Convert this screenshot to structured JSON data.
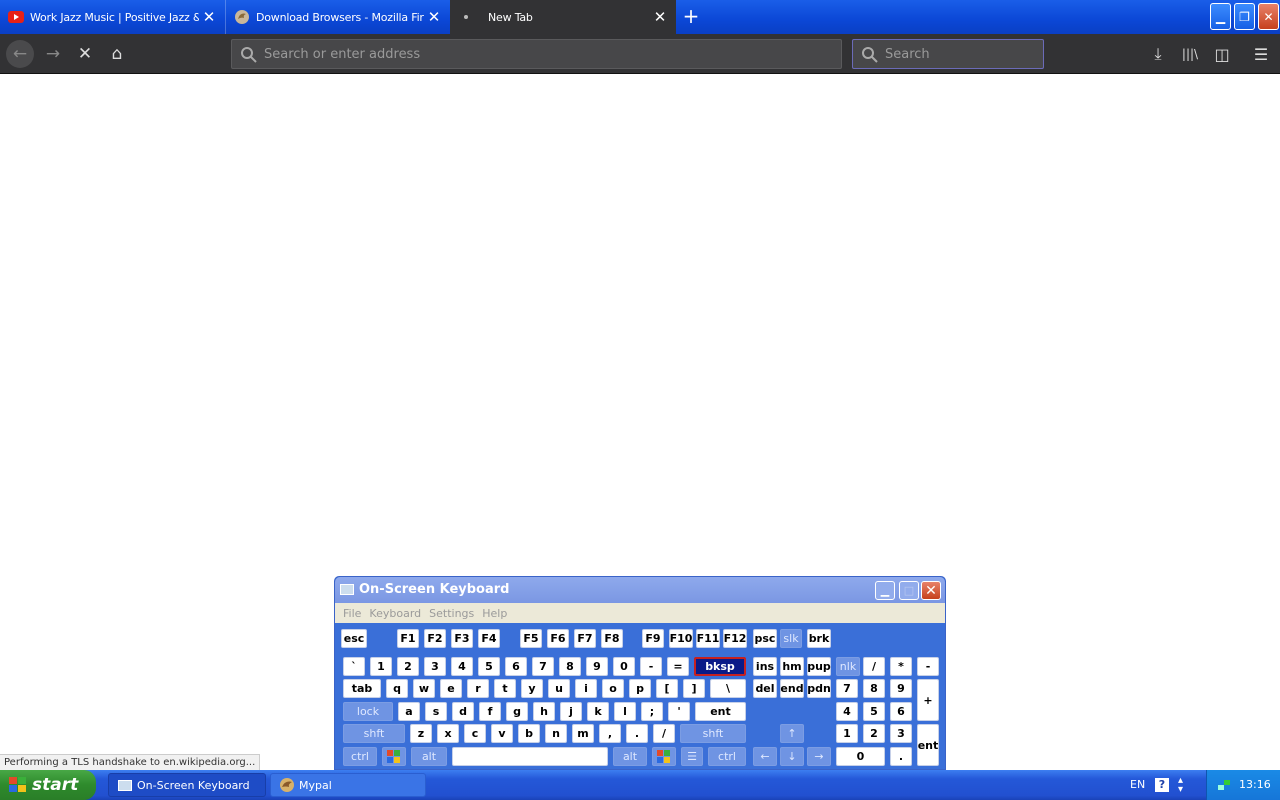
{
  "browser": {
    "tabs": [
      {
        "label": "Work Jazz Music | Positive Jazz &",
        "icon": "youtube-icon",
        "close": "✕"
      },
      {
        "label": "Download Browsers - Mozilla Firef",
        "icon": "mozilla-icon",
        "close": "✕"
      },
      {
        "label": "New Tab",
        "icon": "loading-dot-icon",
        "close": "✕"
      }
    ],
    "new_tab_glyph": "+",
    "window_buttons": {
      "minimize": "▁",
      "restore": "❐",
      "close": "✕"
    },
    "nav": {
      "back": "←",
      "forward": "→",
      "stop": "✕",
      "home": "⌂"
    },
    "url_placeholder": "Search or enter address",
    "search_placeholder": "Search",
    "toolbar_icons": {
      "downloads": "⤓",
      "library": "|||\\",
      "sidebar": "◫",
      "menu": "☰"
    },
    "status": "Performing a TLS handshake to en.wikipedia.org..."
  },
  "osk": {
    "title": "On-Screen Keyboard",
    "menu": [
      "File",
      "Keyboard",
      "Settings",
      "Help"
    ],
    "window_buttons": {
      "minimize": "▁",
      "maximize": "□",
      "close": "✕"
    }
  },
  "taskbar": {
    "start": "start",
    "tasks": [
      {
        "label": "On-Screen Keyboard",
        "icon": "keyboard-icon"
      },
      {
        "label": "Mypal",
        "icon": "mypal-icon"
      }
    ],
    "lang": "EN",
    "help": "?",
    "clock": "13:16"
  },
  "colors": {
    "xp_blue": "#0b47d6",
    "toolbar_dark": "#323234",
    "osk_blue": "#3a6fd8",
    "key_active": "#0a1a88",
    "start_green": "#2e8a2c"
  }
}
